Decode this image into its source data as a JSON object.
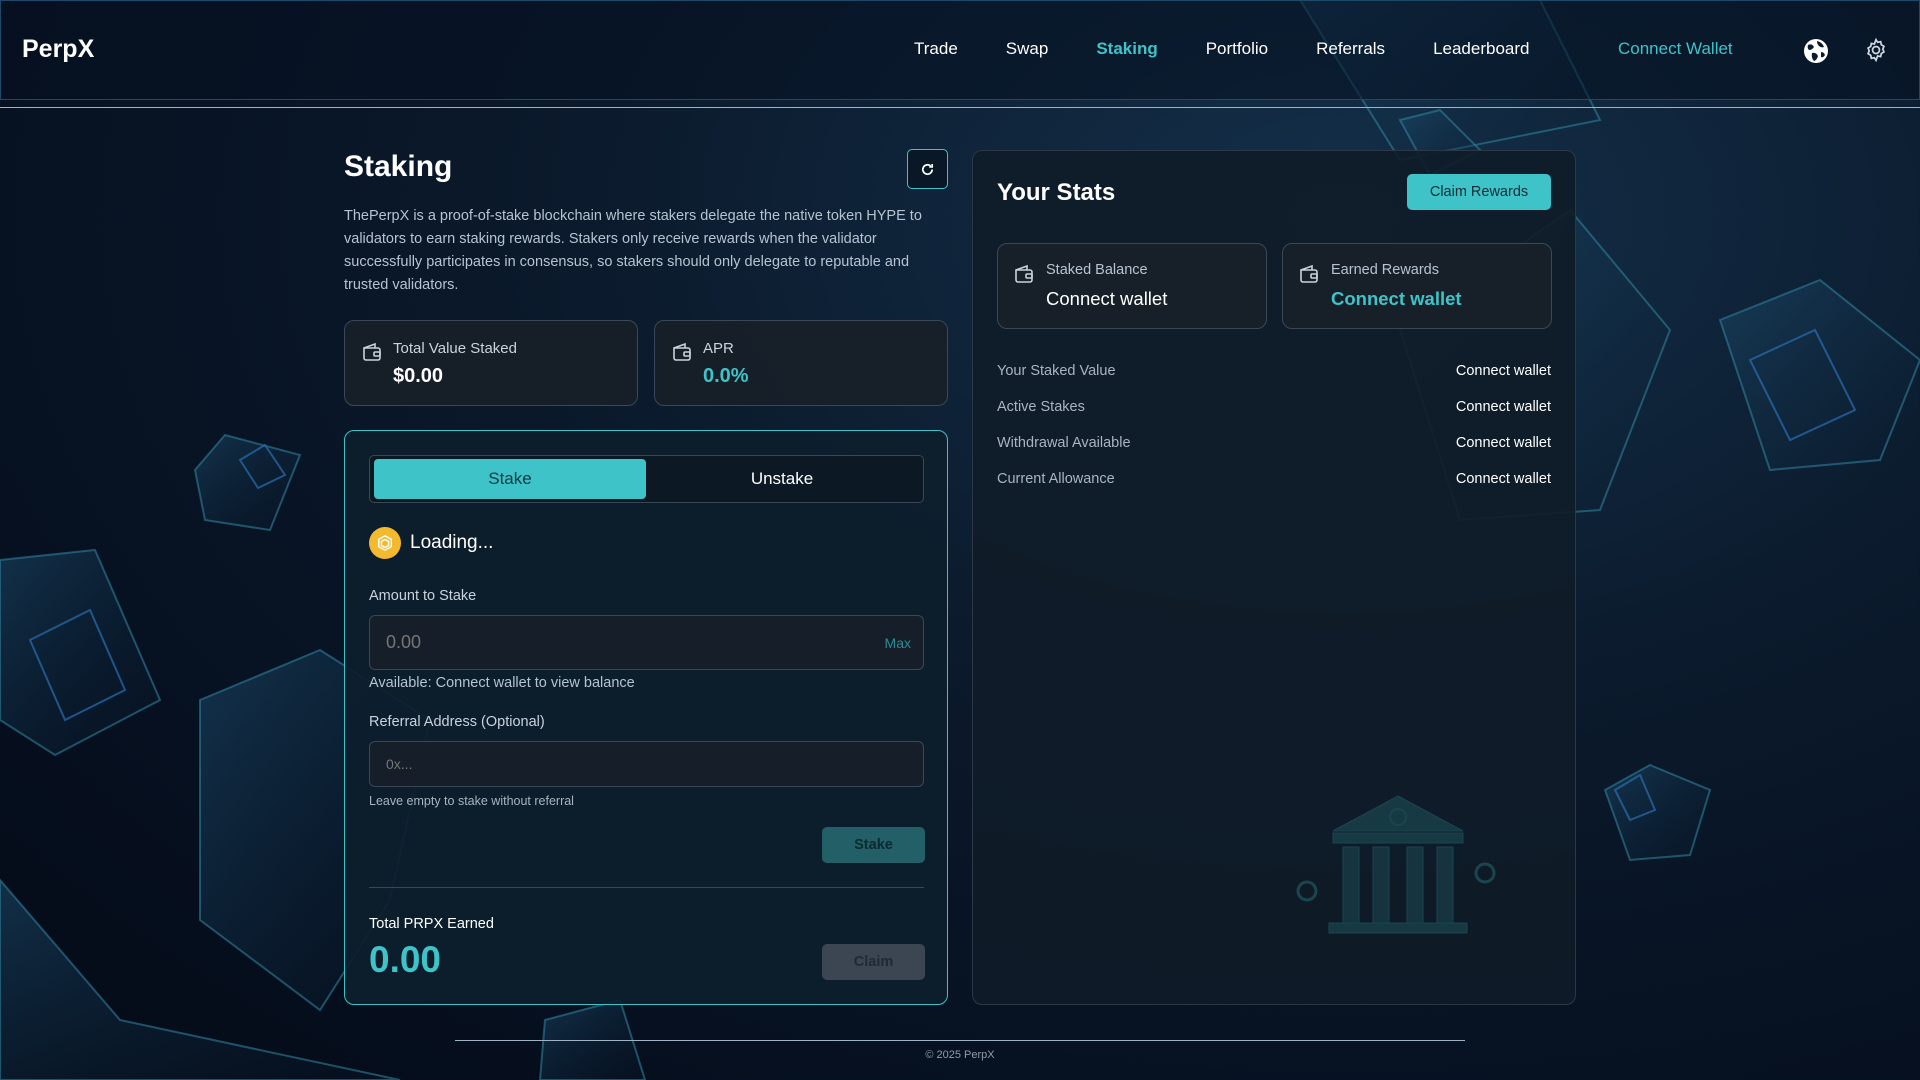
{
  "header": {
    "logo": "PerpX",
    "nav": [
      "Trade",
      "Swap",
      "Staking",
      "Portfolio",
      "Referrals",
      "Leaderboard"
    ],
    "active_nav": "Staking",
    "connect_wallet": "Connect Wallet",
    "icons": [
      "globe-icon",
      "gear-icon"
    ]
  },
  "staking": {
    "title": "Staking",
    "description": "ThePerpX is a proof-of-stake blockchain where stakers delegate the native token HYPE to validators to earn staking rewards. Stakers only receive rewards when the validator successfully participates in consensus, so stakers should only delegate to reputable and trusted validators.",
    "total_value_staked": {
      "label": "Total Value Staked",
      "value": "$0.00"
    },
    "apr": {
      "label": "APR",
      "value": "0.0%"
    }
  },
  "stake_form": {
    "tabs": [
      "Stake",
      "Unstake"
    ],
    "active_tab": "Stake",
    "token_status": "Loading...",
    "amount_label": "Amount to Stake",
    "amount_placeholder": "0.00",
    "max_label": "Max",
    "available_text": "Available: Connect wallet to view balance",
    "referral_label": "Referral Address (Optional)",
    "referral_placeholder": "0x...",
    "referral_hint": "Leave empty to stake without referral",
    "stake_button": "Stake",
    "earned_label": "Total PRPX Earned",
    "earned_value": "0.00",
    "claim_button": "Claim"
  },
  "your_stats": {
    "title": "Your Stats",
    "claim_rewards_button": "Claim Rewards",
    "staked_balance": {
      "label": "Staked Balance",
      "value": "Connect wallet"
    },
    "earned_rewards": {
      "label": "Earned Rewards",
      "value": "Connect wallet"
    },
    "rows": [
      {
        "label": "Your Staked Value",
        "value": "Connect wallet"
      },
      {
        "label": "Active Stakes",
        "value": "Connect wallet"
      },
      {
        "label": "Withdrawal Available",
        "value": "Connect wallet"
      },
      {
        "label": "Current Allowance",
        "value": "Connect wallet"
      }
    ]
  },
  "footer": {
    "copyright": "2025 PerpX"
  },
  "colors": {
    "accent": "#3ec3c9",
    "background": "#0b1a2c",
    "card": "#172029"
  }
}
